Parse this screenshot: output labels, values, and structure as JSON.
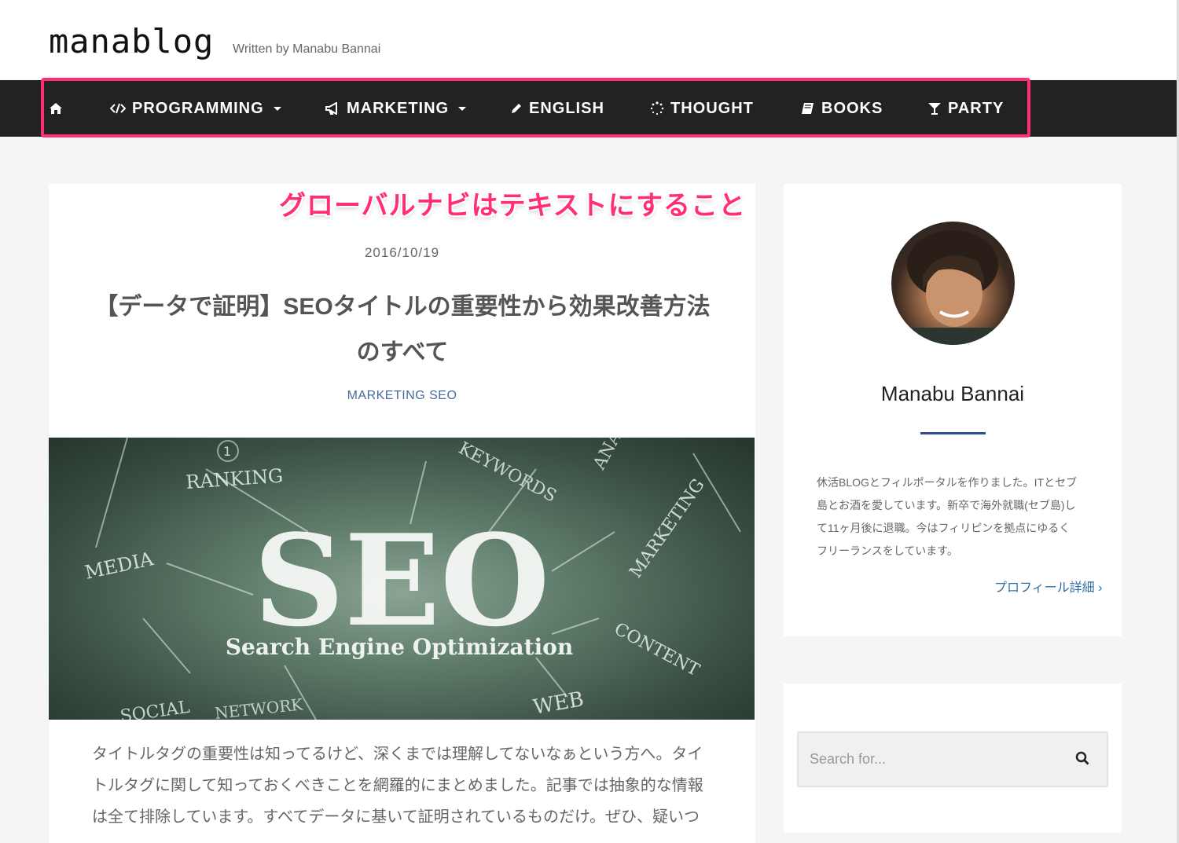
{
  "header": {
    "site_title": "manablog",
    "tagline": "Written by Manabu Bannai"
  },
  "nav": {
    "items": [
      {
        "label": "",
        "icon": "home-icon"
      },
      {
        "label": "PROGRAMMING",
        "icon": "code-icon",
        "has_dropdown": true
      },
      {
        "label": "MARKETING",
        "icon": "megaphone-icon",
        "has_dropdown": true
      },
      {
        "label": "ENGLISH",
        "icon": "pencil-icon"
      },
      {
        "label": "THOUGHT",
        "icon": "spinner-icon"
      },
      {
        "label": "BOOKS",
        "icon": "book-icon"
      },
      {
        "label": "PARTY",
        "icon": "cocktail-icon"
      }
    ],
    "highlight_color": "#ff2f72"
  },
  "annotation": "グローバルナビはテキストにすること",
  "post": {
    "date": "2016/10/19",
    "title_line1": "【データで証明】SEOタイトルの重要性から効果改善方法",
    "title_line2": "のすべて",
    "categories": "MARKETING SEO",
    "hero": {
      "main": "SEO",
      "subtitle": "Search Engine Optimization",
      "words": [
        "RANKING",
        "KEYWORDS",
        "ANALYTICS",
        "MARKETING",
        "MEDIA",
        "CONTENT",
        "WEB",
        "SOCIAL",
        "NETWORK"
      ],
      "badge": "1"
    },
    "excerpt_lines": [
      "タイトルタグの重要性は知ってるけど、深くまでは理解してないなぁという方へ。タイ",
      "トルタグに関して知っておくべきことを網羅的にまとめました。記事では抽象的な情報",
      "は全て排除しています。すべてデータに基いて証明されているものだけ。ぜひ、疑いつ"
    ]
  },
  "sidebar": {
    "profile": {
      "name": "Manabu Bannai",
      "bio_lines": [
        "休活BLOGとフィルポータルを作りました。ITとセブ",
        "島とお酒を愛しています。新卒で海外就職(セブ島)し",
        "て11ヶ月後に退職。今はフィリピンを拠点にゆるく",
        "フリーランスをしています。"
      ],
      "link": "プロフィール詳細 ›"
    },
    "search": {
      "placeholder": "Search for..."
    }
  },
  "colors": {
    "nav_bg": "#222222",
    "accent": "#ff2f72",
    "link": "#2f6fa8",
    "rule": "#2f4d96"
  }
}
